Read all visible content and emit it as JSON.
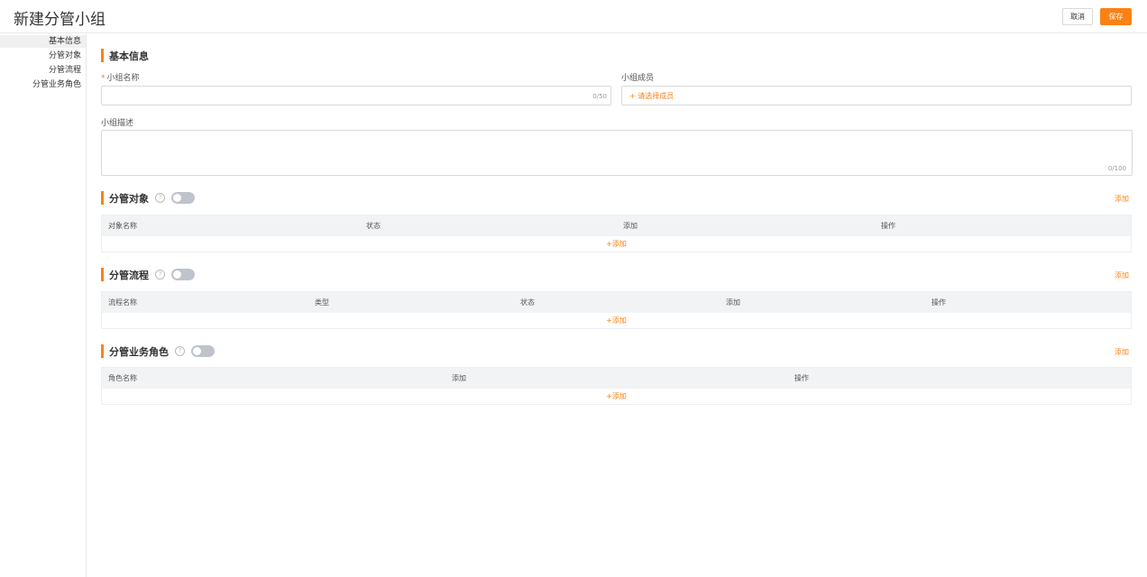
{
  "header": {
    "title": "新建分管小组",
    "cancel_label": "取消",
    "save_label": "保存"
  },
  "sidebar": {
    "items": [
      {
        "label": "基本信息",
        "active": true
      },
      {
        "label": "分管对象",
        "active": false
      },
      {
        "label": "分管流程",
        "active": false
      },
      {
        "label": "分管业务角色",
        "active": false
      }
    ]
  },
  "basic": {
    "title": "基本信息",
    "name_label": "小组名称",
    "name_required_mark": "*",
    "name_value": "",
    "name_counter": "0/50",
    "members_label": "小组成员",
    "members_link": "+ 请选择成员",
    "desc_label": "小组描述",
    "desc_value": "",
    "desc_counter": "0/100"
  },
  "objects": {
    "title": "分管对象",
    "toggle_on": false,
    "add_label": "添加",
    "columns": [
      "对象名称",
      "状态",
      "添加",
      "操作"
    ],
    "row_add_label": "+添加"
  },
  "processes": {
    "title": "分管流程",
    "toggle_on": false,
    "add_label": "添加",
    "columns": [
      "流程名称",
      "类型",
      "状态",
      "添加",
      "操作"
    ],
    "row_add_label": "+添加"
  },
  "roles": {
    "title": "分管业务角色",
    "toggle_on": false,
    "add_label": "添加",
    "columns": [
      "角色名称",
      "添加",
      "操作"
    ],
    "row_add_label": "+添加"
  },
  "colors": {
    "accent": "#fa8214",
    "toggle_off": "#bfc3cc",
    "table_header_bg": "#f2f3f5"
  },
  "icons": {
    "help": "help-circle-icon"
  }
}
